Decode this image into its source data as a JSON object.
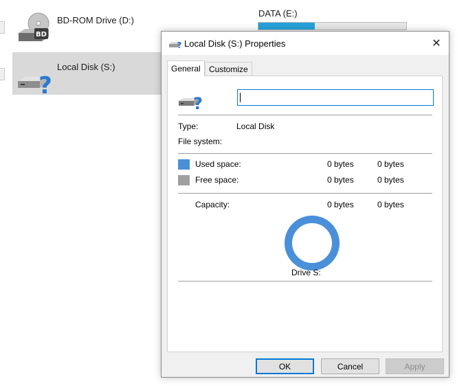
{
  "explorer": {
    "drives": [
      {
        "name": "BD-ROM Drive (D:)",
        "icon": "bd-rom-drive-icon",
        "badge": "BD"
      },
      {
        "name": "Local Disk (S:)",
        "icon": "unknown-disk-icon"
      },
      {
        "name": "DATA (E:)"
      }
    ],
    "data_drive_used_fraction": 0.38
  },
  "dialog": {
    "title": "Local Disk (S:) Properties",
    "close_glyph": "✕",
    "tabs": [
      {
        "label": "General"
      },
      {
        "label": "Customize"
      }
    ],
    "general": {
      "volume_label_value": "",
      "type_label": "Type:",
      "type_value": "Local Disk",
      "filesystem_label": "File system:",
      "used": {
        "label": "Used space:",
        "bytes": "0 bytes",
        "size": "0 bytes"
      },
      "free": {
        "label": "Free space:",
        "bytes": "0 bytes",
        "size": "0 bytes"
      },
      "capacity": {
        "label": "Capacity:",
        "bytes": "0 bytes",
        "size": "0 bytes"
      },
      "drive_label": "Drive S:"
    },
    "buttons": {
      "ok": "OK",
      "cancel": "Cancel",
      "apply": "Apply"
    }
  },
  "colors": {
    "used_space": "#4a90d9",
    "free_space": "#a0a0a0",
    "selection": "#d9d9d9",
    "accent": "#0078d7",
    "usage_fill": "#26a0da"
  }
}
